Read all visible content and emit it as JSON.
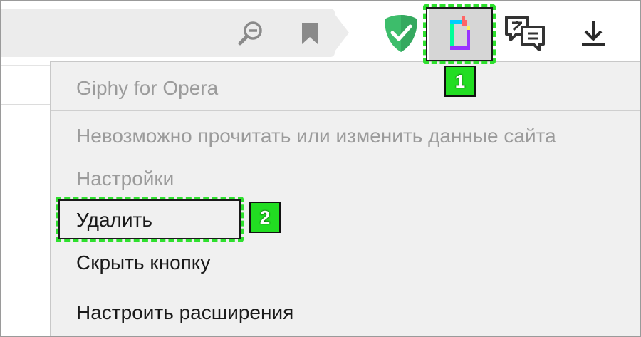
{
  "toolbar": {
    "icons": {
      "zoom": "zoom-out-icon",
      "bookmark": "bookmark-icon",
      "adguard": "adguard-shield-icon",
      "giphy": "giphy-extension-icon",
      "translate": "translator-icon",
      "download": "download-icon"
    }
  },
  "menu": {
    "title": "Giphy for Opera",
    "permission": "Невозможно прочитать или изменить данные сайта",
    "settings": "Настройки",
    "remove": "Удалить",
    "hide_button": "Скрыть кнопку",
    "manage_extensions": "Настроить расширения"
  },
  "annotations": {
    "badge_1": "1",
    "badge_2": "2"
  },
  "colors": {
    "highlight": "#2ee02e",
    "adguard_green": "#3dbd6b",
    "menu_background": "#f0f0f0"
  }
}
